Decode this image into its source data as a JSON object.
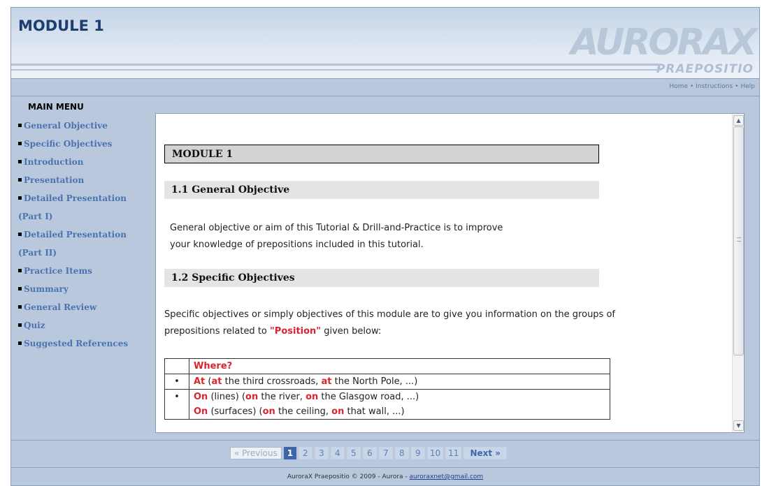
{
  "header": {
    "title": "MODULE 1",
    "logo_main": "AURORAX",
    "logo_sub": "PRAEPOSITIO"
  },
  "topnav": {
    "home": "Home",
    "instructions": "Instructions",
    "help": "Help",
    "separator": "•"
  },
  "sidebar": {
    "title": "MAIN MENU",
    "items": [
      {
        "label": "General Objective"
      },
      {
        "label": "Specific Objectives"
      },
      {
        "label": "Introduction"
      },
      {
        "label": "Presentation"
      },
      {
        "label": "Detailed Presentation"
      },
      {
        "label": "(Part I)"
      },
      {
        "label": "Detailed Presentation"
      },
      {
        "label": "(Part II)"
      },
      {
        "label": "Practice Items"
      },
      {
        "label": "Summary"
      },
      {
        "label": "General Review"
      },
      {
        "label": "Quiz"
      },
      {
        "label": "Suggested References"
      }
    ]
  },
  "content": {
    "module_heading": "MODULE 1",
    "section1_heading": "1.1 General Objective",
    "section1_text_line1": "General objective or aim of this Tutorial & Drill-and-Practice is to improve",
    "section1_text_line2": "your knowledge of prepositions included in this tutorial.",
    "section2_heading": "1.2 Specific Objectives",
    "section2_text_line1": "Specific objectives or simply objectives of this module are to give you information on the groups of",
    "section2_text_line2_pre": "prepositions related to ",
    "section2_text_line2_highlight": "\"Position\"",
    "section2_text_line2_post": " given below:",
    "table": {
      "header": "Where?",
      "bullet": "•",
      "row1": {
        "kw": "At",
        "a": " (",
        "k1": "at",
        "b": " the third crossroads, ",
        "k2": "at",
        "c": " the North Pole, ...)"
      },
      "row2": {
        "kw": "On",
        "a": " (lines) (",
        "k1": "on",
        "b": " the river, ",
        "k2": "on",
        "c": " the Glasgow road, ...)"
      },
      "row3": {
        "kw": "On",
        "a": " (surfaces) (",
        "k1": "on",
        "b": " the ceiling, ",
        "k2": "on",
        "c": " that wall, ...)"
      }
    }
  },
  "pagination": {
    "previous": "« Previous",
    "pages": [
      "1",
      "2",
      "3",
      "4",
      "5",
      "6",
      "7",
      "8",
      "9",
      "10",
      "11"
    ],
    "current": "1",
    "next": "Next »"
  },
  "footer": {
    "text": "AuroraX Praepositio © 2009 - Aurora - ",
    "email": "auroraxnet@gmail.com"
  },
  "colors": {
    "panel": "#b9c8dc",
    "menu_link": "#4b73b0",
    "highlight_red": "#d9262e",
    "current_page": "#3d67a6"
  }
}
